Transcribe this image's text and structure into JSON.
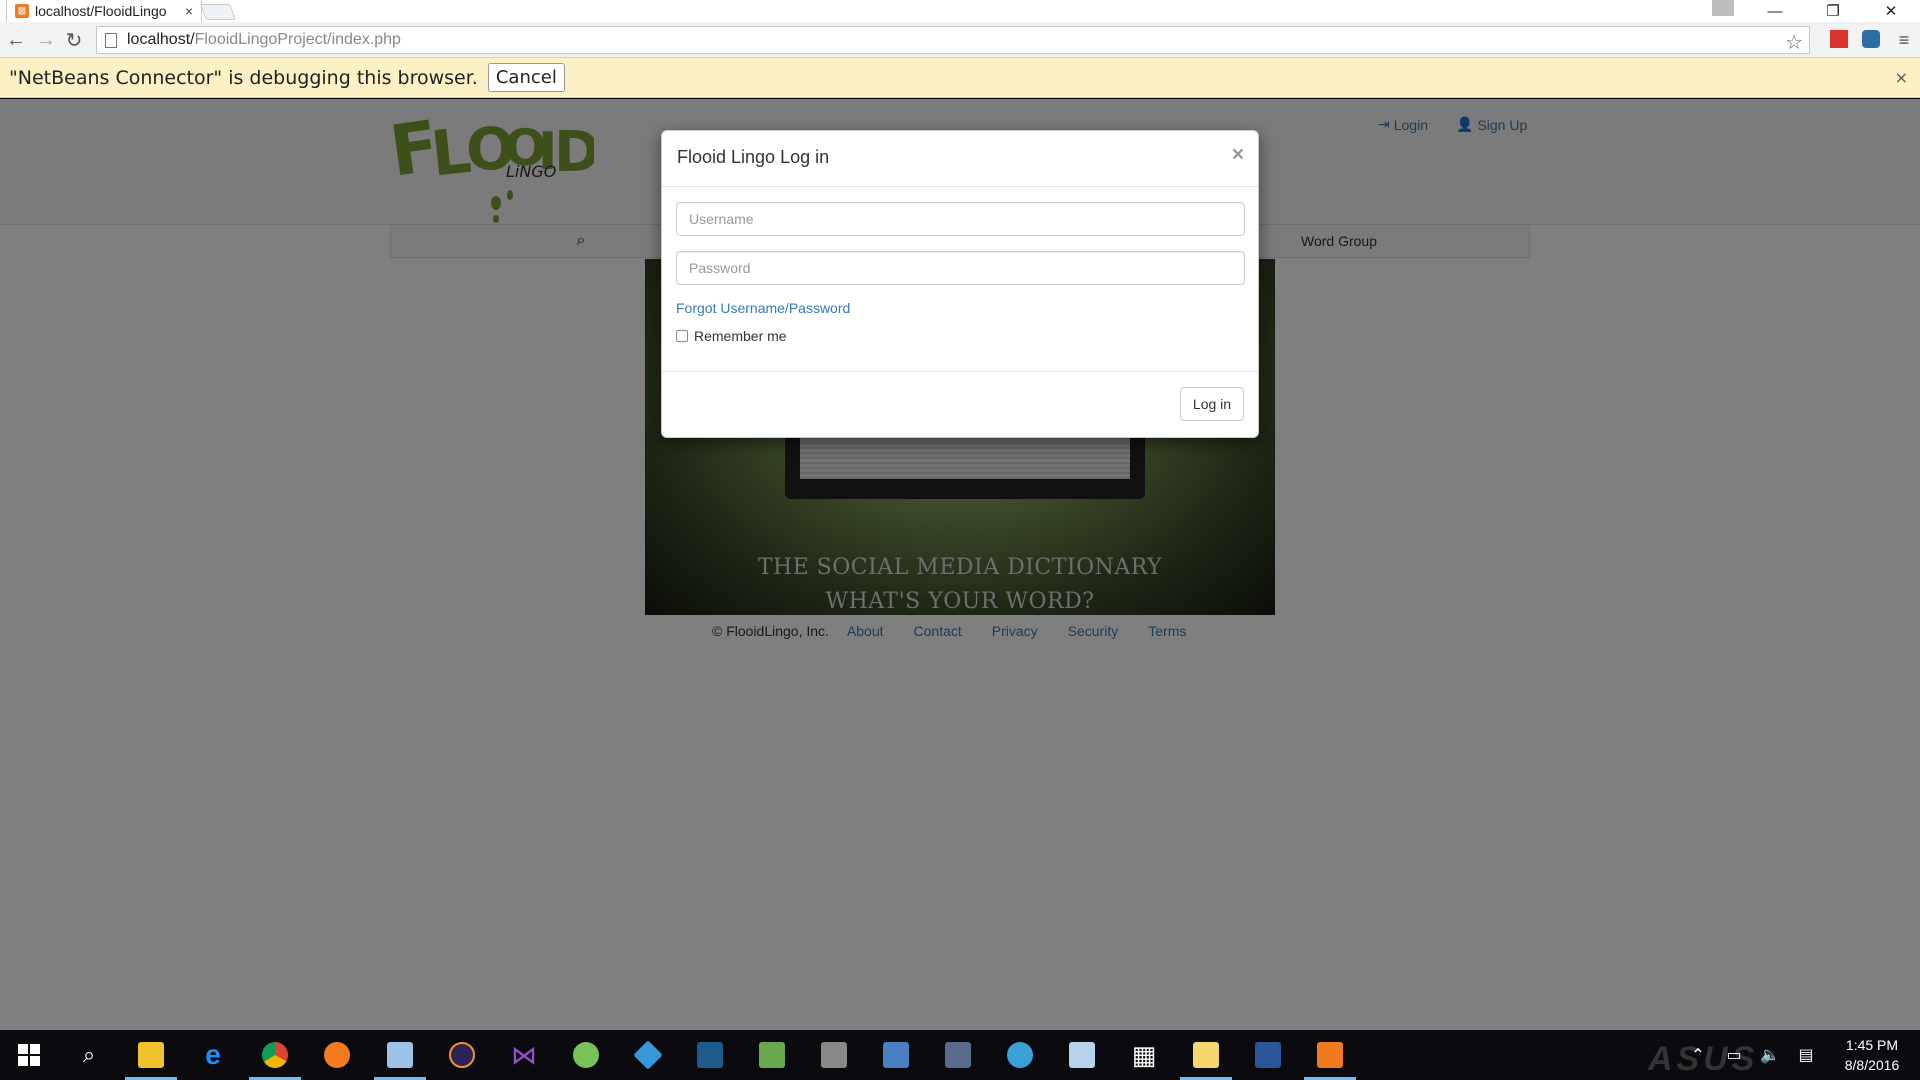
{
  "browser": {
    "tab_title": "localhost/FlooidLingo",
    "tab_close": "×",
    "url_host": "localhost/",
    "url_path": "FlooidLingoProject/index.php",
    "nav": {
      "back": "←",
      "forward": "→",
      "reload": "↻"
    },
    "star": "☆",
    "window": {
      "minimize": "—",
      "restore": "❐",
      "close": "✕"
    },
    "infobar": {
      "message": "\"NetBeans Connector\" is debugging this browser.",
      "cancel_label": "Cancel",
      "close": "×"
    },
    "menu": "≡"
  },
  "site": {
    "header_links": [
      {
        "icon": "login-icon",
        "label": "Login"
      },
      {
        "icon": "user-icon",
        "label": "Sign Up"
      }
    ],
    "navbar": {
      "search_icon": "⌕",
      "word_group": "Word Group"
    },
    "hero": {
      "tagline_line1": "THE SOCIAL MEDIA DICTIONARY",
      "tagline_line2": "WHAT'S YOUR WORD?"
    },
    "footer": {
      "copyright": "© FlooidLingo, Inc.",
      "links": [
        "About",
        "Contact",
        "Privacy",
        "Security",
        "Terms"
      ]
    }
  },
  "login_modal": {
    "title": "Flooid Lingo Log in",
    "close": "×",
    "username_placeholder": "Username",
    "password_placeholder": "Password",
    "forgot_link": "Forgot Username/Password",
    "remember_label": "Remember me",
    "remember_checked": false,
    "submit_label": "Log in"
  },
  "taskbar": {
    "time": "1:45 PM",
    "date": "8/8/2016",
    "active_app": "chrome-icon",
    "brand": "ASUS"
  },
  "colors": {
    "infobar_bg": "#fcf1c5",
    "link_blue": "#337ab7",
    "logo_green": "#7ca033",
    "taskbar_bg": "#0b0b0f"
  }
}
